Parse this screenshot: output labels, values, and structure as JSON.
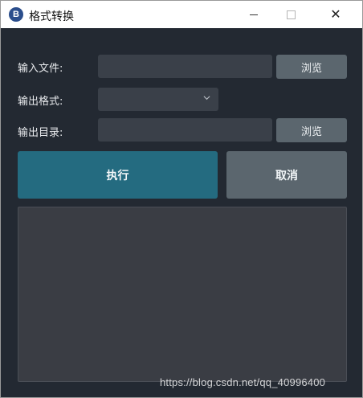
{
  "window": {
    "title": "格式转换",
    "icon_letter": "B",
    "controls": {
      "minimize": "minimize-icon",
      "maximize": "maximize-icon",
      "close": "close-icon"
    }
  },
  "form": {
    "input_file_label": "输入文件:",
    "input_file_value": "",
    "browse_input_label": "浏览",
    "output_format_label": "输出格式:",
    "output_format_value": "",
    "output_dir_label": "输出目录:",
    "output_dir_value": "",
    "browse_output_label": "浏览"
  },
  "actions": {
    "execute_label": "执行",
    "cancel_label": "取消"
  },
  "log": {
    "content": ""
  },
  "watermark": "https://blog.csdn.net/qq_40996400",
  "colors": {
    "background": "#232932",
    "field": "#3a4049",
    "execute": "#246b80",
    "secondary_button": "#5b666e",
    "output": "#3a3d44"
  }
}
